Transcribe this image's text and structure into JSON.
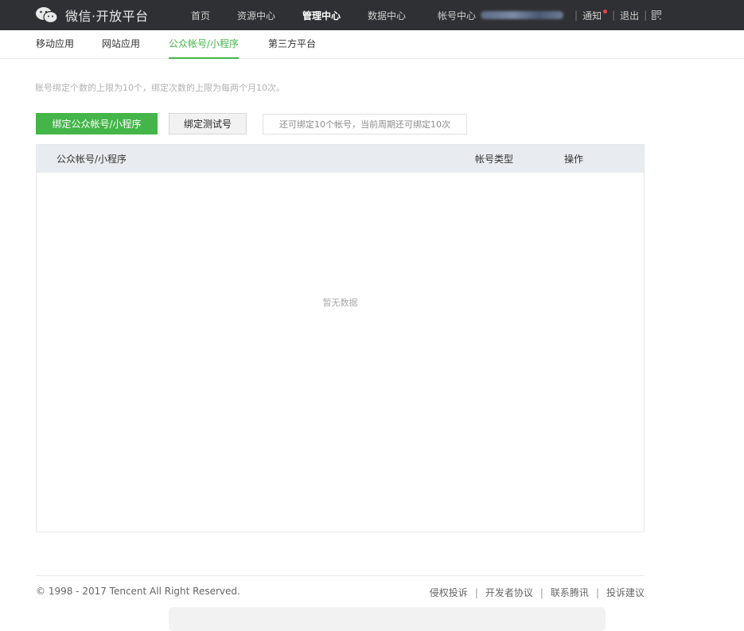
{
  "topbar": {
    "brand": "微信·开放平台",
    "nav": [
      {
        "label": "首页",
        "active": false
      },
      {
        "label": "资源中心",
        "active": false
      },
      {
        "label": "管理中心",
        "active": true
      },
      {
        "label": "数据中心",
        "active": false
      }
    ],
    "account_label": "帐号中心",
    "notice": "通知",
    "logout": "退出",
    "separator": "|"
  },
  "subnav": {
    "tabs": [
      {
        "label": "移动应用",
        "active": false
      },
      {
        "label": "网站应用",
        "active": false
      },
      {
        "label": "公众帐号/小程序",
        "active": true
      },
      {
        "label": "第三方平台",
        "active": false
      }
    ]
  },
  "main": {
    "hint": "账号绑定个数的上限为10个，绑定次数的上限为每两个月10次。",
    "bind_button": "绑定公众帐号/小程序",
    "bind_test_button": "绑定测试号",
    "quota_text": "还可绑定10个帐号，当前周期还可绑定10次",
    "table": {
      "columns": [
        "公众帐号/小程序",
        "帐号类型",
        "操作"
      ],
      "empty_text": "暂无数据"
    }
  },
  "footer": {
    "copyright": "© 1998 - 2017 Tencent All Right Reserved.",
    "links": [
      "侵权投诉",
      "开发者协议",
      "联系腾讯",
      "投诉建议"
    ],
    "separator": "|"
  },
  "colors": {
    "topbar_bg": "#2f3033",
    "accent_green": "#44b549",
    "table_header_bg": "#e8ecf0",
    "notice_dot": "#e64340"
  }
}
